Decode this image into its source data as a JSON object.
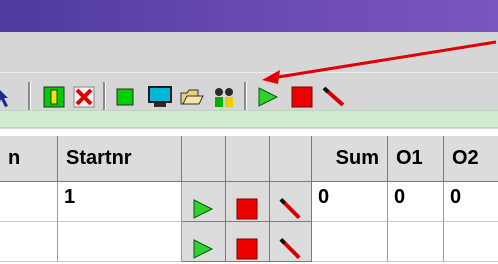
{
  "toolbar": {
    "icons": [
      "pointer-icon",
      "pencil-icon",
      "delete-icon",
      "green-square-icon",
      "monitor-icon",
      "open-folder-icon",
      "people-icon",
      "play-icon",
      "stop-icon",
      "stick-icon"
    ]
  },
  "grid": {
    "headers": [
      "n",
      "Startnr",
      "",
      "",
      "",
      "Sum",
      "O1",
      "O2"
    ],
    "rows": [
      {
        "startnr": "1",
        "sum": "0",
        "o1": "0",
        "o2": "0"
      },
      {
        "startnr": "",
        "sum": "",
        "o1": "",
        "o2": ""
      }
    ]
  },
  "colors": {
    "title_bar": "#6a4bb4",
    "accent_arrow": "#e0000a",
    "play_green": "#24b524",
    "stop_red": "#ef0000"
  }
}
